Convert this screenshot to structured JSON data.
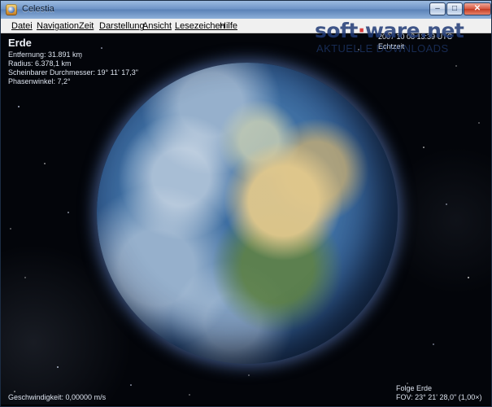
{
  "window": {
    "title": "Celestia",
    "controls": {
      "minimize": "–",
      "maximize": "□",
      "close": "✕"
    }
  },
  "menu": {
    "items": [
      "Datei",
      "Navigation",
      "Zeit",
      "Darstellung",
      "Ansicht",
      "Lesezeichen",
      "Hilfe"
    ]
  },
  "info": {
    "name": "Erde",
    "distance": "Entfernung: 31.891 km",
    "radius": "Radius: 6.378,1 km",
    "apparent_diameter": "Scheinbarer Durchmesser: 19° 11' 17,3\"",
    "phase_angle": "Phasenwinkel: 7,2°"
  },
  "time": {
    "datetime": "2007 10 08 13:39 UTC",
    "mode": "Echtzeit"
  },
  "status": {
    "speed": "Geschwindigkeit: 0,00000 m/s",
    "follow": "Folge Erde",
    "fov": "FOV: 23° 21' 28,0\" (1,00×)"
  },
  "watermark": {
    "main_left": "soft",
    "main_right": "ware",
    "suffix": ".net",
    "subtitle": "AKTUELLE DOWNLOADS"
  },
  "scene": {
    "icons": [
      "celestia-app-icon",
      "earth-globe"
    ],
    "accent_color": "#6f95c7",
    "background_color": "#03050a"
  }
}
